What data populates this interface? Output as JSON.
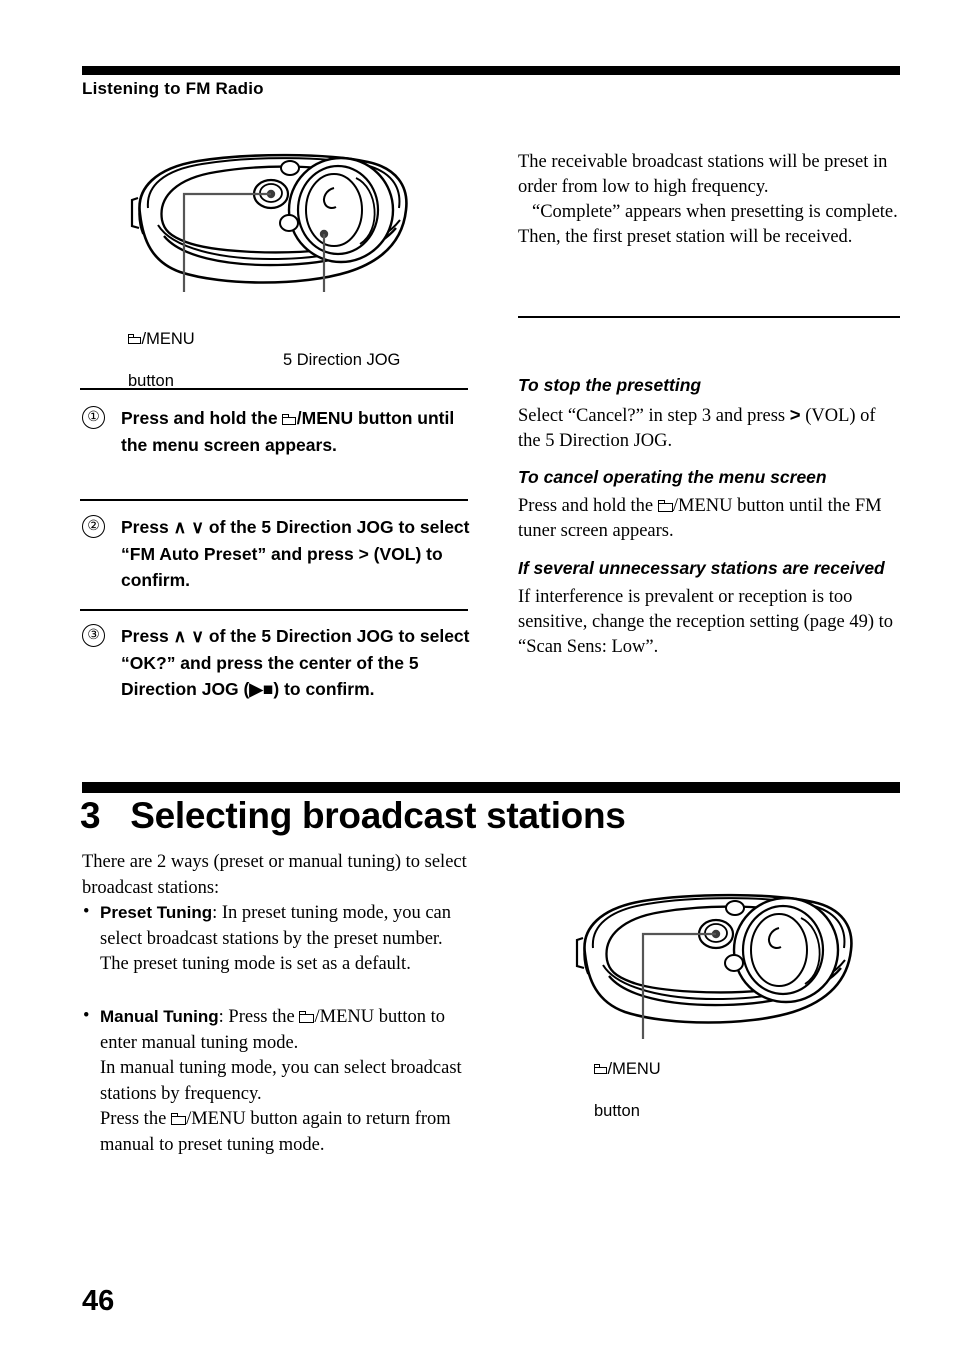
{
  "header": {
    "running_head": "Listening to FM Radio"
  },
  "figure_top": {
    "callout_menu_line1": "/MENU",
    "callout_menu_line2": "button",
    "callout_jog": "5 Direction JOG",
    "icon_menu": "folder-icon"
  },
  "steps": [
    {
      "number": "①",
      "text": "Press and hold the  /MENU button until the menu screen appears.",
      "segments": {
        "before": "Press and hold the ",
        "after": "/MENU button until the menu screen appears."
      }
    },
    {
      "number": "②",
      "text": "Press ∧ ∨ of the 5 Direction JOG to select “FM Auto Preset” and press > (VOL) to confirm."
    },
    {
      "number": "③",
      "text": "Press ∧ ∨ of the 5 Direction JOG to select “OK?” and press the center of the 5 Direction JOG (▶■) to confirm."
    }
  ],
  "right_column": {
    "intro_para1": "The receivable broadcast stations will be preset in order from low to high frequency.",
    "intro_para2": "“Complete” appears when presetting is complete. Then, the first preset station will be received.",
    "sections": [
      {
        "heading": "To stop the presetting",
        "body_before": "Select “Cancel?” in step 3 and press ",
        "body_symbol": ">",
        "body_after": " (VOL) of the 5 Direction JOG."
      },
      {
        "heading": "To cancel operating the menu screen",
        "body_before": "Press and hold the ",
        "body_after": "/MENU button until the FM tuner screen appears."
      },
      {
        "heading": "If several unnecessary stations are received",
        "body": "If interference is prevalent or reception is too sensitive, change the reception setting (page 49) to “Scan Sens: Low”."
      }
    ]
  },
  "section": {
    "number": "3",
    "title": "Selecting broadcast stations",
    "heading_full": "3   Selecting broadcast stations",
    "intro": "There are 2 ways (preset or manual tuning) to select broadcast stations:",
    "bullets": [
      {
        "term": "Preset Tuning",
        "body": ": In preset tuning mode, you can select broadcast stations by the preset number.",
        "extra": "The preset tuning mode is set as a default."
      },
      {
        "term": "Manual Tuning",
        "body_before": ": Press the ",
        "body_after": "/MENU button to enter manual tuning mode.",
        "extra1": "In manual tuning mode, you can select broadcast stations by frequency.",
        "extra2_before": "Press the ",
        "extra2_after": "/MENU button again to return from manual to preset tuning mode."
      }
    ]
  },
  "figure_bottom": {
    "callout_menu_line1": "/MENU",
    "callout_menu_line2": "button",
    "icon_menu": "folder-icon"
  },
  "folio": {
    "page_number": "46"
  },
  "colors": {
    "ink": "#000000",
    "paper": "#ffffff",
    "leader": "#555555"
  }
}
